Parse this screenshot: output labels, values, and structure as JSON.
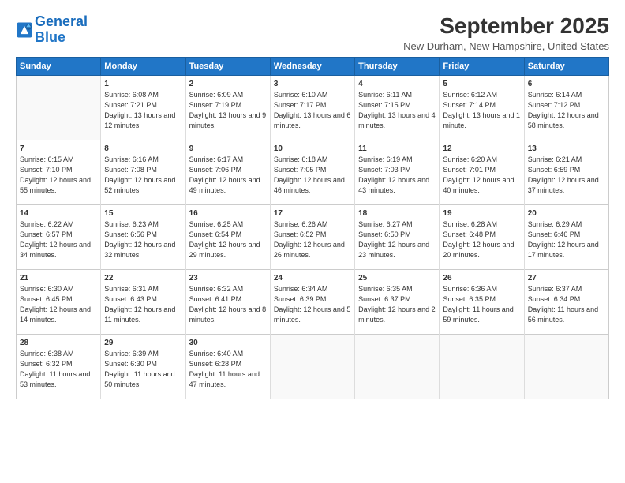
{
  "logo": {
    "line1": "General",
    "line2": "Blue"
  },
  "title": "September 2025",
  "location": "New Durham, New Hampshire, United States",
  "days_of_week": [
    "Sunday",
    "Monday",
    "Tuesday",
    "Wednesday",
    "Thursday",
    "Friday",
    "Saturday"
  ],
  "weeks": [
    [
      {
        "num": "",
        "rise": "",
        "set": "",
        "daylight": ""
      },
      {
        "num": "1",
        "rise": "Sunrise: 6:08 AM",
        "set": "Sunset: 7:21 PM",
        "daylight": "Daylight: 13 hours and 12 minutes."
      },
      {
        "num": "2",
        "rise": "Sunrise: 6:09 AM",
        "set": "Sunset: 7:19 PM",
        "daylight": "Daylight: 13 hours and 9 minutes."
      },
      {
        "num": "3",
        "rise": "Sunrise: 6:10 AM",
        "set": "Sunset: 7:17 PM",
        "daylight": "Daylight: 13 hours and 6 minutes."
      },
      {
        "num": "4",
        "rise": "Sunrise: 6:11 AM",
        "set": "Sunset: 7:15 PM",
        "daylight": "Daylight: 13 hours and 4 minutes."
      },
      {
        "num": "5",
        "rise": "Sunrise: 6:12 AM",
        "set": "Sunset: 7:14 PM",
        "daylight": "Daylight: 13 hours and 1 minute."
      },
      {
        "num": "6",
        "rise": "Sunrise: 6:14 AM",
        "set": "Sunset: 7:12 PM",
        "daylight": "Daylight: 12 hours and 58 minutes."
      }
    ],
    [
      {
        "num": "7",
        "rise": "Sunrise: 6:15 AM",
        "set": "Sunset: 7:10 PM",
        "daylight": "Daylight: 12 hours and 55 minutes."
      },
      {
        "num": "8",
        "rise": "Sunrise: 6:16 AM",
        "set": "Sunset: 7:08 PM",
        "daylight": "Daylight: 12 hours and 52 minutes."
      },
      {
        "num": "9",
        "rise": "Sunrise: 6:17 AM",
        "set": "Sunset: 7:06 PM",
        "daylight": "Daylight: 12 hours and 49 minutes."
      },
      {
        "num": "10",
        "rise": "Sunrise: 6:18 AM",
        "set": "Sunset: 7:05 PM",
        "daylight": "Daylight: 12 hours and 46 minutes."
      },
      {
        "num": "11",
        "rise": "Sunrise: 6:19 AM",
        "set": "Sunset: 7:03 PM",
        "daylight": "Daylight: 12 hours and 43 minutes."
      },
      {
        "num": "12",
        "rise": "Sunrise: 6:20 AM",
        "set": "Sunset: 7:01 PM",
        "daylight": "Daylight: 12 hours and 40 minutes."
      },
      {
        "num": "13",
        "rise": "Sunrise: 6:21 AM",
        "set": "Sunset: 6:59 PM",
        "daylight": "Daylight: 12 hours and 37 minutes."
      }
    ],
    [
      {
        "num": "14",
        "rise": "Sunrise: 6:22 AM",
        "set": "Sunset: 6:57 PM",
        "daylight": "Daylight: 12 hours and 34 minutes."
      },
      {
        "num": "15",
        "rise": "Sunrise: 6:23 AM",
        "set": "Sunset: 6:56 PM",
        "daylight": "Daylight: 12 hours and 32 minutes."
      },
      {
        "num": "16",
        "rise": "Sunrise: 6:25 AM",
        "set": "Sunset: 6:54 PM",
        "daylight": "Daylight: 12 hours and 29 minutes."
      },
      {
        "num": "17",
        "rise": "Sunrise: 6:26 AM",
        "set": "Sunset: 6:52 PM",
        "daylight": "Daylight: 12 hours and 26 minutes."
      },
      {
        "num": "18",
        "rise": "Sunrise: 6:27 AM",
        "set": "Sunset: 6:50 PM",
        "daylight": "Daylight: 12 hours and 23 minutes."
      },
      {
        "num": "19",
        "rise": "Sunrise: 6:28 AM",
        "set": "Sunset: 6:48 PM",
        "daylight": "Daylight: 12 hours and 20 minutes."
      },
      {
        "num": "20",
        "rise": "Sunrise: 6:29 AM",
        "set": "Sunset: 6:46 PM",
        "daylight": "Daylight: 12 hours and 17 minutes."
      }
    ],
    [
      {
        "num": "21",
        "rise": "Sunrise: 6:30 AM",
        "set": "Sunset: 6:45 PM",
        "daylight": "Daylight: 12 hours and 14 minutes."
      },
      {
        "num": "22",
        "rise": "Sunrise: 6:31 AM",
        "set": "Sunset: 6:43 PM",
        "daylight": "Daylight: 12 hours and 11 minutes."
      },
      {
        "num": "23",
        "rise": "Sunrise: 6:32 AM",
        "set": "Sunset: 6:41 PM",
        "daylight": "Daylight: 12 hours and 8 minutes."
      },
      {
        "num": "24",
        "rise": "Sunrise: 6:34 AM",
        "set": "Sunset: 6:39 PM",
        "daylight": "Daylight: 12 hours and 5 minutes."
      },
      {
        "num": "25",
        "rise": "Sunrise: 6:35 AM",
        "set": "Sunset: 6:37 PM",
        "daylight": "Daylight: 12 hours and 2 minutes."
      },
      {
        "num": "26",
        "rise": "Sunrise: 6:36 AM",
        "set": "Sunset: 6:35 PM",
        "daylight": "Daylight: 11 hours and 59 minutes."
      },
      {
        "num": "27",
        "rise": "Sunrise: 6:37 AM",
        "set": "Sunset: 6:34 PM",
        "daylight": "Daylight: 11 hours and 56 minutes."
      }
    ],
    [
      {
        "num": "28",
        "rise": "Sunrise: 6:38 AM",
        "set": "Sunset: 6:32 PM",
        "daylight": "Daylight: 11 hours and 53 minutes."
      },
      {
        "num": "29",
        "rise": "Sunrise: 6:39 AM",
        "set": "Sunset: 6:30 PM",
        "daylight": "Daylight: 11 hours and 50 minutes."
      },
      {
        "num": "30",
        "rise": "Sunrise: 6:40 AM",
        "set": "Sunset: 6:28 PM",
        "daylight": "Daylight: 11 hours and 47 minutes."
      },
      {
        "num": "",
        "rise": "",
        "set": "",
        "daylight": ""
      },
      {
        "num": "",
        "rise": "",
        "set": "",
        "daylight": ""
      },
      {
        "num": "",
        "rise": "",
        "set": "",
        "daylight": ""
      },
      {
        "num": "",
        "rise": "",
        "set": "",
        "daylight": ""
      }
    ]
  ]
}
